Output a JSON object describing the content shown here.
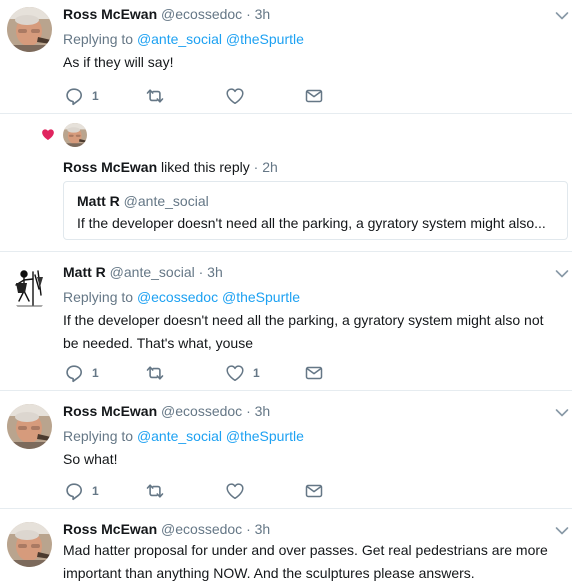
{
  "tweets": [
    {
      "name": "Ross McEwan",
      "handle": "@ecossedoc",
      "time": "3h",
      "replying_prefix": "Replying to",
      "reply_to": [
        "@ante_social",
        "@theSpurtle"
      ],
      "text": "As if they will say!",
      "reply_count": "1",
      "like_count": ""
    },
    {
      "name": "Matt R",
      "handle": "@ante_social",
      "time": "3h",
      "replying_prefix": "Replying to",
      "reply_to": [
        "@ecossedoc",
        "@theSpurtle"
      ],
      "text_lines": [
        "If the developer doesn't need all the parking, a gyratory system might also not",
        "be needed. That's what, youse"
      ],
      "reply_count": "1",
      "like_count": "1"
    },
    {
      "name": "Ross McEwan",
      "handle": "@ecossedoc",
      "time": "3h",
      "replying_prefix": "Replying to",
      "reply_to": [
        "@ante_social",
        "@theSpurtle"
      ],
      "text": "So what!",
      "reply_count": "1",
      "like_count": ""
    },
    {
      "name": "Ross McEwan",
      "handle": "@ecossedoc",
      "time": "3h",
      "text_lines": [
        "Mad hatter proposal for under and over passes. Get real pedestrians are more",
        "important than anything NOW. And the sculptures please answers."
      ]
    }
  ],
  "activity": {
    "actor": "Ross McEwan",
    "action": "liked this reply",
    "time": "2h",
    "quoted": {
      "name": "Matt R",
      "handle": "@ante_social",
      "text": "If the developer doesn't need all the parking, a gyratory system might also..."
    }
  },
  "separator": "·",
  "colors": {
    "accent": "#1da1f2",
    "heart": "#e0245e",
    "muted": "#657786",
    "text": "#14171a",
    "border": "#e6ecf0"
  },
  "icons": [
    "reply-icon",
    "retweet-icon",
    "like-icon",
    "message-icon",
    "chevron-down-icon",
    "heart-filled-icon"
  ]
}
